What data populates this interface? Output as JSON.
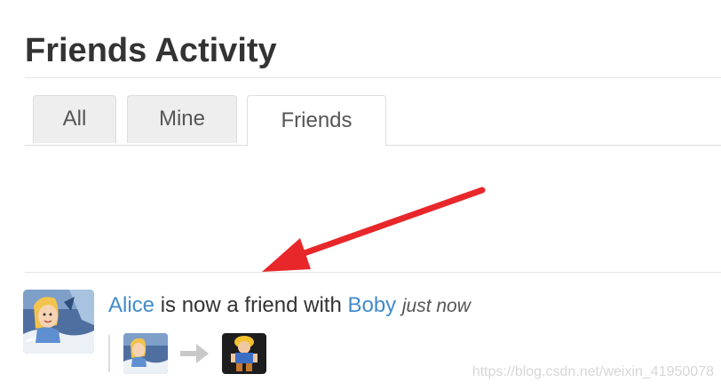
{
  "page": {
    "title": "Friends Activity"
  },
  "tabs": [
    {
      "label": "All",
      "active": false
    },
    {
      "label": "Mine",
      "active": false
    },
    {
      "label": "Friends",
      "active": true
    }
  ],
  "activity": {
    "actor": "Alice",
    "action": "is now a friend with",
    "target": "Boby",
    "time": "just now"
  },
  "icons": {
    "avatar": "alice-avatar",
    "arrow": "arrow-right-icon",
    "annotation": "red-annotation-arrow"
  },
  "colors": {
    "link": "#428bca",
    "annotation_arrow": "#e8272b",
    "active_tab_bg": "#ffffff",
    "inactive_tab_bg": "#eeeeee"
  },
  "watermark": "https://blog.csdn.net/weixin_41950078"
}
